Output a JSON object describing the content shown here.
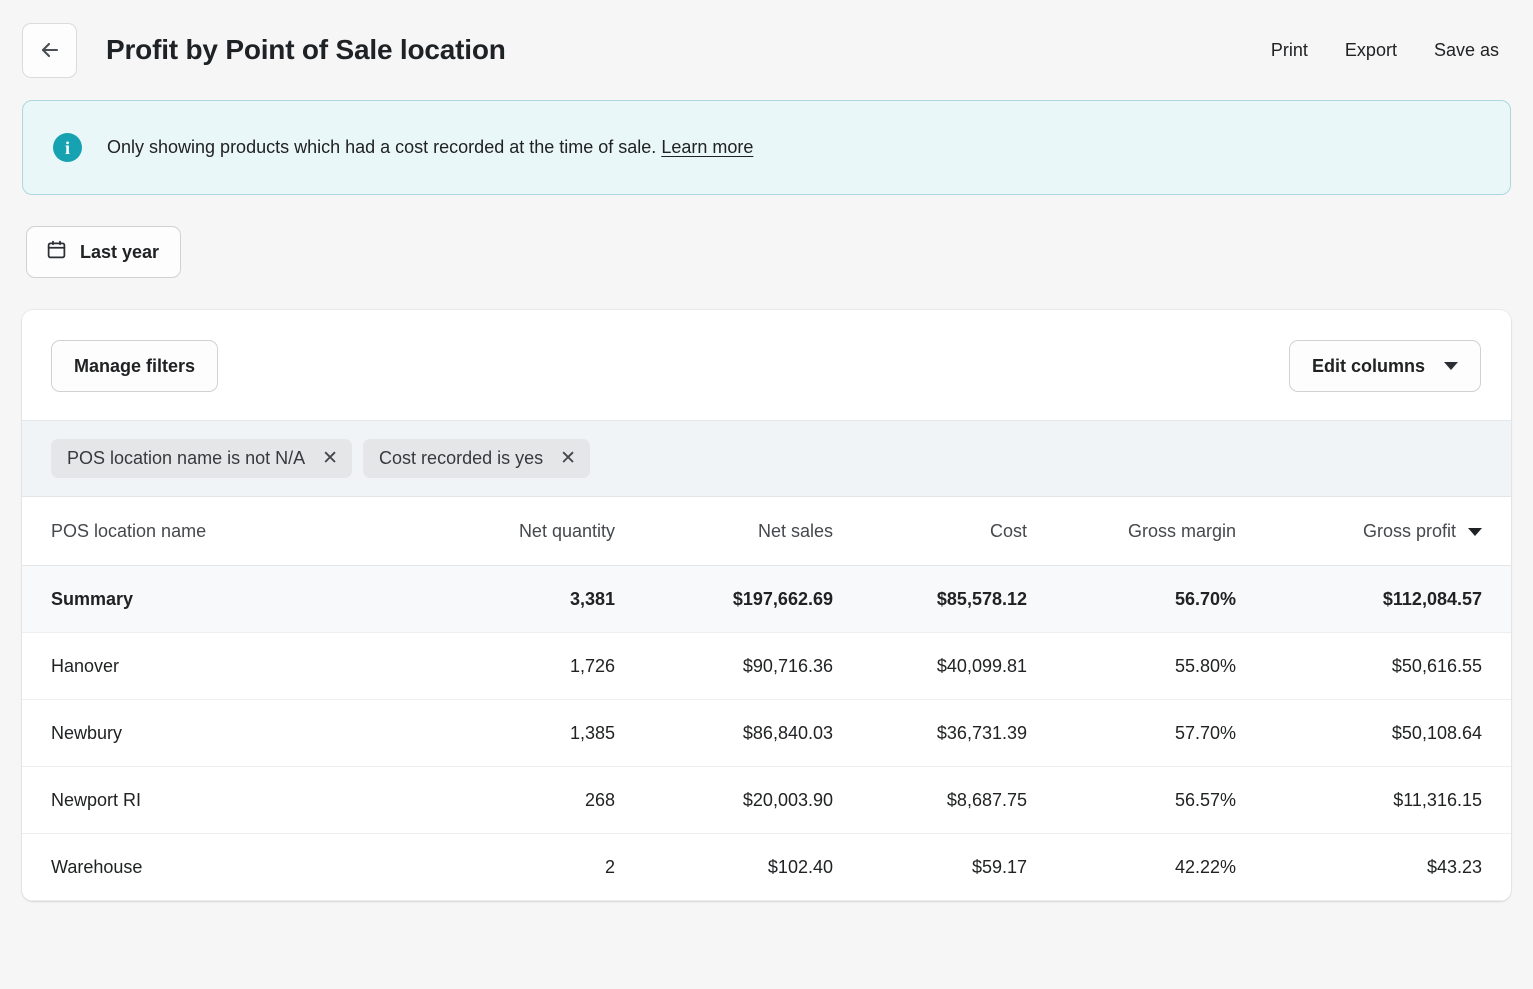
{
  "header": {
    "back_icon": "arrow-left-icon",
    "title": "Profit by Point of Sale location",
    "actions": [
      {
        "label": "Print"
      },
      {
        "label": "Export"
      },
      {
        "label": "Save as"
      }
    ]
  },
  "banner": {
    "icon": "info-circle-icon",
    "icon_color": "#17a2b2",
    "background": "#eaf7f9",
    "text": "Only showing products which had a cost recorded at the time of sale.",
    "link_label": "Learn more"
  },
  "date_filter": {
    "icon": "calendar-icon",
    "label": "Last year"
  },
  "toolbar": {
    "manage_filters_label": "Manage filters",
    "edit_columns_label": "Edit columns",
    "edit_columns_icon": "chevron-down-icon"
  },
  "filter_chips": [
    {
      "label": "POS location name is not N/A",
      "remove_icon": "close-icon"
    },
    {
      "label": "Cost recorded is yes",
      "remove_icon": "close-icon"
    }
  ],
  "table": {
    "sorted_column": "Gross profit",
    "sort_direction": "descending",
    "sort_icon": "caret-down-icon",
    "columns": [
      {
        "label": "POS location name",
        "align": "left"
      },
      {
        "label": "Net quantity",
        "align": "right"
      },
      {
        "label": "Net sales",
        "align": "right"
      },
      {
        "label": "Cost",
        "align": "right"
      },
      {
        "label": "Gross margin",
        "align": "right"
      },
      {
        "label": "Gross profit",
        "align": "right"
      }
    ],
    "summary": {
      "name": "Summary",
      "net_quantity": "3,381",
      "net_sales": "$197,662.69",
      "cost": "$85,578.12",
      "gross_margin": "56.70%",
      "gross_profit": "$112,084.57"
    },
    "rows": [
      {
        "name": "Hanover",
        "net_quantity": "1,726",
        "net_sales": "$90,716.36",
        "cost": "$40,099.81",
        "gross_margin": "55.80%",
        "gross_profit": "$50,616.55"
      },
      {
        "name": "Newbury",
        "net_quantity": "1,385",
        "net_sales": "$86,840.03",
        "cost": "$36,731.39",
        "gross_margin": "57.70%",
        "gross_profit": "$50,108.64"
      },
      {
        "name": "Newport RI",
        "net_quantity": "268",
        "net_sales": "$20,003.90",
        "cost": "$8,687.75",
        "gross_margin": "56.57%",
        "gross_profit": "$11,316.15"
      },
      {
        "name": "Warehouse",
        "net_quantity": "2",
        "net_sales": "$102.40",
        "cost": "$59.17",
        "gross_margin": "42.22%",
        "gross_profit": "$43.23"
      }
    ]
  }
}
